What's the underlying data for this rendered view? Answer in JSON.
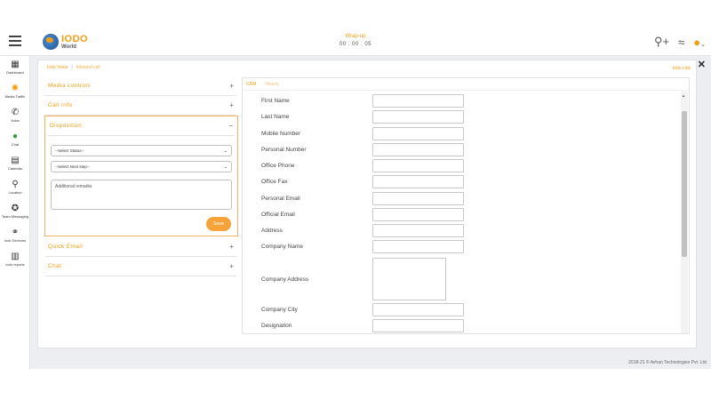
{
  "header": {
    "logo_name": "IODO",
    "logo_sub": "World",
    "wrap_title": "Wrap-up",
    "wrap_time": "00 : 00 : 05",
    "icons": [
      "add-user-icon",
      "wifi-icon",
      "avatar-icon"
    ]
  },
  "sidebar": {
    "items": [
      {
        "label": "Dashboard",
        "icon": "dashboard-icon",
        "glyph": "▦"
      },
      {
        "label": "Media Traffic",
        "icon": "media-traffic-icon",
        "glyph": "✺"
      },
      {
        "label": "Voice",
        "icon": "phone-icon",
        "glyph": "✆"
      },
      {
        "label": "Chat",
        "icon": "chat-icon",
        "glyph": "●"
      },
      {
        "label": "Calendar",
        "icon": "calendar-icon",
        "glyph": "▤"
      },
      {
        "label": "Location",
        "icon": "location-icon",
        "glyph": "⚲"
      },
      {
        "label": "Team Messaging",
        "icon": "team-messaging-icon",
        "glyph": "✪"
      },
      {
        "label": "Iodo Services",
        "icon": "services-icon",
        "glyph": "⚭"
      },
      {
        "label": "Iodo reports",
        "icon": "reports-icon",
        "glyph": "▥"
      }
    ]
  },
  "breadcrumb": {
    "main": "Iodo Voice",
    "sub": "Inbound call",
    "right": "Iodo Link"
  },
  "accordions": {
    "media_controls": "Media controls",
    "call_info": "Call Info",
    "disposition": "Disposition",
    "quick_email": "Quick Email",
    "chat": "Chat",
    "plus": "+",
    "minus": "−"
  },
  "disposition": {
    "status_select": "--Select Status--",
    "next_step_select": "--Select Next step--",
    "remarks_placeholder": "Additional remarks",
    "save_label": "Save"
  },
  "crm": {
    "tabs": [
      "CRM",
      "History"
    ],
    "fields": [
      "First Name",
      "Last Name",
      "Mobile Number",
      "Personal Number",
      "Office Phone",
      "Office Fax",
      "Personal Email",
      "Official Email",
      "Address",
      "Company Name",
      "Company Address",
      "Company City",
      "Designation"
    ]
  },
  "footer": {
    "copyright": "2018-21 © Avhan Technologies Pvt. Ltd."
  }
}
